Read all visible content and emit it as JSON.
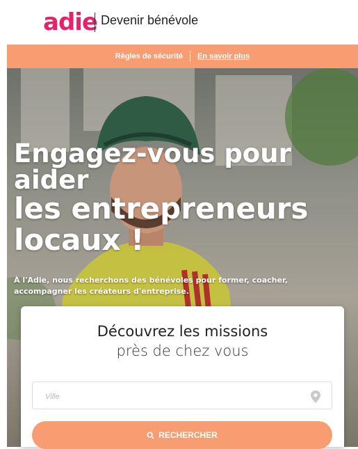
{
  "header": {
    "logo_text": "adie",
    "tagline": "Devenir bénévole"
  },
  "banner": {
    "safety_rules": "Règles de sécurité",
    "learn_more": "En savoir plus",
    "color": "#f89d71"
  },
  "hero": {
    "title_lines": [
      "Engagez-vous pour",
      "aider",
      "les entrepreneurs",
      "locaux !"
    ],
    "subtitle": "À l'Adie, nous recherchons des bénévoles pour former, coacher, accompagner les créateurs d'entreprise."
  },
  "search_card": {
    "title": "Découvrez les missions",
    "subtitle": "près de chez vous",
    "city_placeholder": "Ville",
    "pin_icon": "map-pin-icon",
    "button_label": "RECHERCHER",
    "button_icon": "search-icon"
  },
  "colors": {
    "brand": "#e5226b",
    "accent": "#f89d71"
  }
}
